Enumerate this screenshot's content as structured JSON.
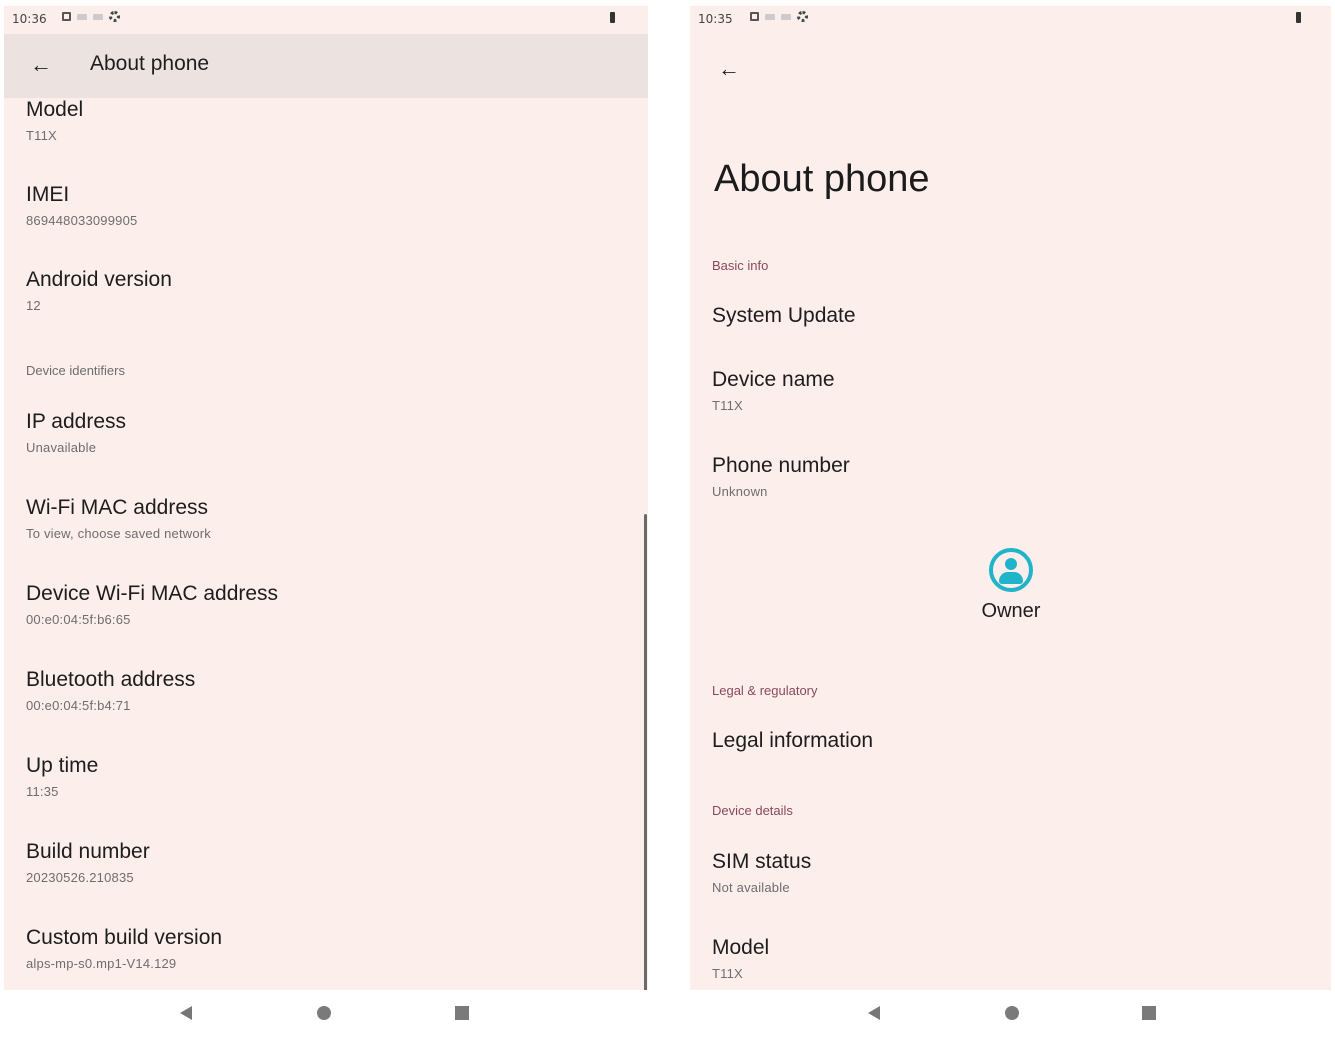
{
  "left": {
    "status_time": "10:36",
    "appbar_title": "About phone",
    "items": [
      {
        "title": "Model",
        "sub": "T11X"
      },
      {
        "title": "IMEI",
        "sub": "869448033099905"
      },
      {
        "title": "Android version",
        "sub": "12"
      },
      {
        "title": "IP address",
        "sub": "Unavailable"
      },
      {
        "title": "Wi-Fi MAC address",
        "sub": "To view, choose saved network"
      },
      {
        "title": "Device Wi-Fi MAC address",
        "sub": "00:e0:04:5f:b6:65"
      },
      {
        "title": "Bluetooth address",
        "sub": "00:e0:04:5f:b4:71"
      },
      {
        "title": "Up time",
        "sub": "11:35"
      },
      {
        "title": "Build number",
        "sub": "20230526.210835"
      },
      {
        "title": "Custom build version",
        "sub": "alps-mp-s0.mp1-V14.129"
      }
    ],
    "section_device_identifiers": "Device identifiers"
  },
  "right": {
    "status_time": "10:35",
    "page_title": "About phone",
    "section_basic_info": "Basic info",
    "system_update": "System Update",
    "device_name": {
      "title": "Device name",
      "sub": "T11X"
    },
    "phone_number": {
      "title": "Phone number",
      "sub": "Unknown"
    },
    "owner_label": "Owner",
    "section_legal": "Legal & regulatory",
    "legal_information": "Legal information",
    "section_device_details": "Device details",
    "sim_status": {
      "title": "SIM status",
      "sub": "Not available"
    },
    "model": {
      "title": "Model",
      "sub": "T11X"
    }
  },
  "icons": {
    "back": "back-arrow-icon",
    "owner": "account-circle-icon",
    "nav_back": "nav-back-icon",
    "nav_home": "nav-home-icon",
    "nav_recents": "nav-recents-icon"
  },
  "colors": {
    "background": "#fbeeeb",
    "appbar": "#ece3e1",
    "owner_accent": "#1fb4c9",
    "section_accent": "#8a4a5c"
  }
}
